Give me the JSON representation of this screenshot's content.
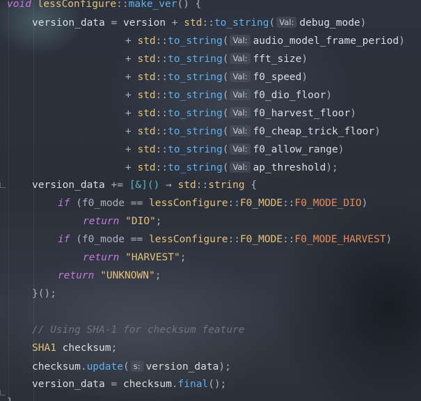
{
  "editor": {
    "function_header": {
      "keyword": "void",
      "class_name": "lessConfigure",
      "scope_op": "::",
      "method": "make_ver",
      "suffix": "() {"
    },
    "version_block": {
      "lhs": "version_data",
      "assign": " = ",
      "base": "version",
      "plus": " + ",
      "std": "std",
      "to_string": "to_string",
      "open": "(",
      "hint": "Val:",
      "first_arg": "debug_mode",
      "close": ")",
      "args": [
        "audio_model_frame_period",
        "fft_size",
        "f0_speed",
        "f0_dio_floor",
        "f0_harvest_floor",
        "f0_cheap_trick_floor",
        "f0_allow_range",
        "ap_threshold"
      ],
      "last_close": ");"
    },
    "lambda_line": {
      "lhs": "version_data",
      "op": " += ",
      "capture": "[&]()",
      "arrow": " → ",
      "std": "std",
      "type": "string",
      "brace": " {"
    },
    "if_dio": {
      "keyword": "if",
      "open": " (f0_mode ",
      "eq": "==",
      "class_name": "lessConfigure",
      "enum_type": "F0_MODE",
      "enum_value": "F0_MODE_DIO",
      "close": ")"
    },
    "return_dio": {
      "keyword": "return",
      "value": "\"DIO\"",
      "semi": ";"
    },
    "if_harvest": {
      "keyword": "if",
      "open": " (f0_mode ",
      "eq": "==",
      "class_name": "lessConfigure",
      "enum_type": "F0_MODE",
      "enum_value": "F0_MODE_HARVEST",
      "close": ")"
    },
    "return_harvest": {
      "keyword": "return",
      "value": "\"HARVEST\"",
      "semi": ";"
    },
    "return_unknown": {
      "keyword": "return",
      "value": "\"UNKNOWN\"",
      "semi": ";"
    },
    "lambda_end": "}();",
    "comment": "// Using SHA-1 for checksum feature",
    "sha_decl": {
      "type": "SHA1",
      "name": " checksum",
      "semi": ";"
    },
    "update_line": {
      "obj": "checksum",
      "dot": ".",
      "method": "update",
      "open": "(",
      "hint": "s:",
      "arg": "version_data",
      "close": ");"
    },
    "final_line": {
      "lhs": "version_data",
      "assign": " = ",
      "obj": "checksum",
      "dot": ".",
      "method": "final",
      "close": "();"
    },
    "closing_brace": "}"
  },
  "colors": {
    "background": "#2a2f39",
    "keyword": "#c678dd",
    "function": "#61afef",
    "type": "#e5c07b",
    "enum_value": "#e88a5a",
    "text": "#d8dee6",
    "comment": "#6a7385"
  }
}
